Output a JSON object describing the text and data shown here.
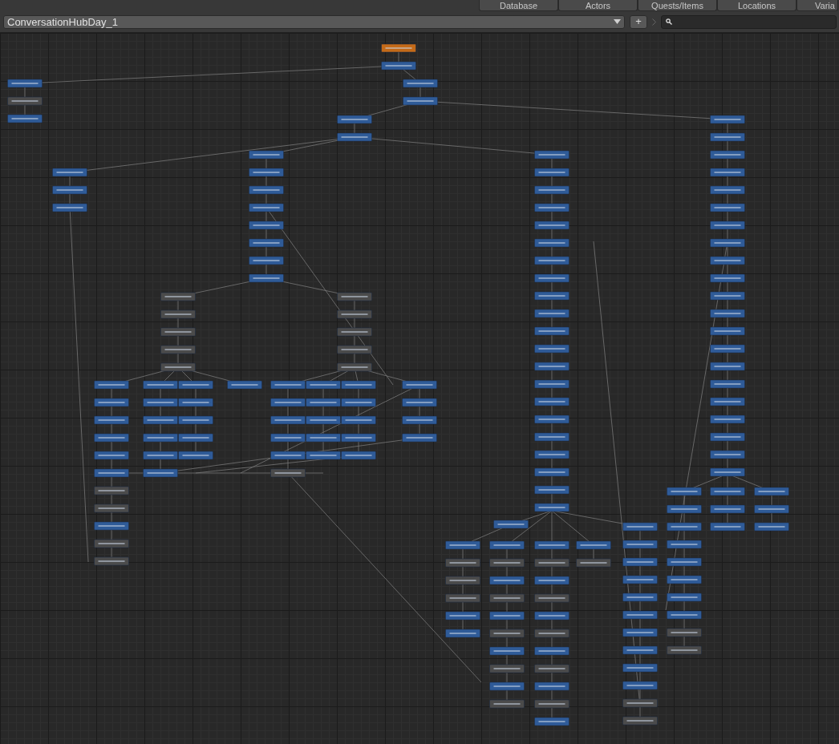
{
  "tabs": [
    {
      "label": "Database"
    },
    {
      "label": "Actors"
    },
    {
      "label": "Quests/Items"
    },
    {
      "label": "Locations"
    },
    {
      "label": "Varia"
    }
  ],
  "conversation_selector": {
    "value": "ConversationHubDay_1"
  },
  "add_button": {
    "label": "+"
  }
}
